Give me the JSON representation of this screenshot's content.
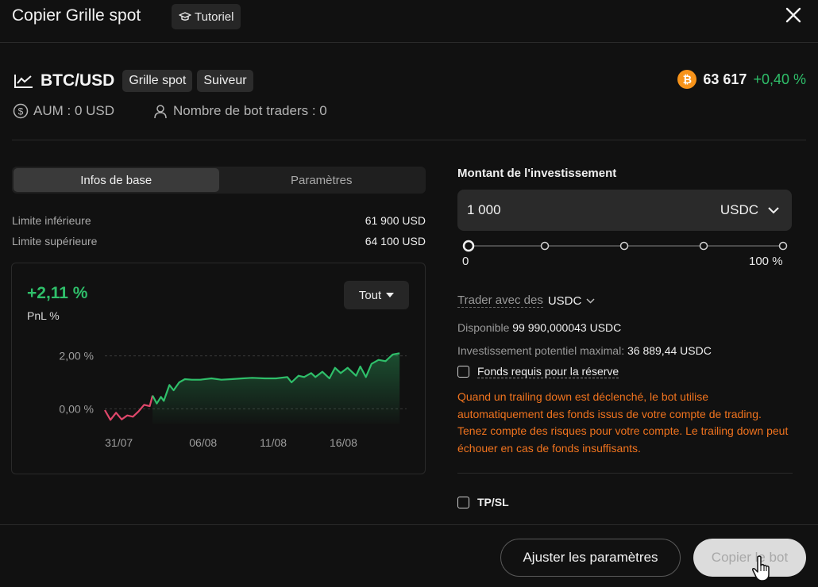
{
  "header": {
    "title": "Copier Grille spot",
    "tutorial_label": "Tutoriel"
  },
  "pair": {
    "name": "BTC/USD",
    "tags": [
      "Grille spot",
      "Suiveur"
    ],
    "coin_symbol": "₿",
    "price": "63 617",
    "change": "+0,40 %",
    "aum": "AUM : 0 USD",
    "bot_traders": "Nombre de bot traders : 0"
  },
  "left": {
    "tabs": [
      "Infos de base",
      "Paramètres"
    ],
    "active_tab": 0,
    "lower_limit_label": "Limite inférieure",
    "lower_limit_value": "61 900 USD",
    "upper_limit_label": "Limite supérieure",
    "upper_limit_value": "64 100 USD"
  },
  "chart_data": {
    "type": "area",
    "pnl_value": "+2,11 %",
    "ylabel": "PnL %",
    "range_label": "Tout",
    "ytick_labels": [
      "2,00 %",
      "0,00 %"
    ],
    "yticks": [
      2.0,
      0.0
    ],
    "ylim": [
      -0.5,
      2.5
    ],
    "xtick_labels": [
      "31/07",
      "06/08",
      "11/08",
      "16/08"
    ],
    "xtick_days": [
      0,
      6,
      11,
      16
    ],
    "xlim": [
      -1,
      20.5
    ],
    "grid": true,
    "series": [
      {
        "x": [
          -1,
          -0.6,
          -0.2,
          0.2,
          0.6,
          1.0,
          1.4,
          1.8,
          2.2,
          2.4,
          2.7,
          3.0,
          3.2,
          3.6,
          3.9,
          4.3,
          4.7,
          5.2,
          5.8,
          6.6,
          7.3,
          8,
          8.8,
          9.5,
          10.4,
          11.2,
          12,
          12.3,
          12.8,
          13.2,
          13.7,
          14,
          14.5,
          15,
          15.4,
          15.8,
          16.3,
          16.9,
          17.2,
          17.6,
          18,
          18.5,
          19,
          19.5,
          20
        ],
        "y": [
          -0.05,
          -0.42,
          -0.15,
          -0.4,
          -0.25,
          -0.3,
          -0.1,
          0.15,
          0.1,
          0.5,
          0.2,
          0.45,
          0.3,
          0.9,
          0.7,
          1.0,
          1.12,
          1.1,
          1.1,
          1.15,
          1.1,
          1.12,
          1.15,
          1.17,
          1.15,
          1.15,
          1.2,
          1.0,
          1.25,
          1.2,
          1.35,
          1.2,
          1.4,
          1.15,
          1.55,
          1.35,
          1.55,
          1.25,
          1.6,
          1.2,
          1.7,
          1.85,
          1.8,
          2.05,
          2.1
        ]
      }
    ]
  },
  "right": {
    "investment_label": "Montant de l'investissement",
    "amount": "1 000",
    "currency": "USDC",
    "slider_fraction": 0,
    "slider_min": "0",
    "slider_max": "100 %",
    "trade_with_label": "Trader avec des",
    "trade_with_currency": "USDC",
    "available_label": "Disponible",
    "available_value": "99 990,000043 USDC",
    "max_investment_label": "Investissement potentiel maximal:",
    "max_investment_value": "36 889,44 USDC",
    "reserve_label": "Fonds requis pour la réserve",
    "warning": "Quand un trailing down est déclenché, le bot utilise automatiquement des fonds issus de votre compte de trading. Tenez compte des risques pour votre compte. Le trailing down peut échouer en cas de fonds insuffisants.",
    "tpsl_label": "TP/SL"
  },
  "footer": {
    "adjust_label": "Ajuster les paramètres",
    "copy_label": "Copier le bot"
  },
  "colors": {
    "positive": "#2fbf6a",
    "negative": "#e0476b",
    "warning": "#f0731e",
    "bitcoin": "#f7931a"
  }
}
